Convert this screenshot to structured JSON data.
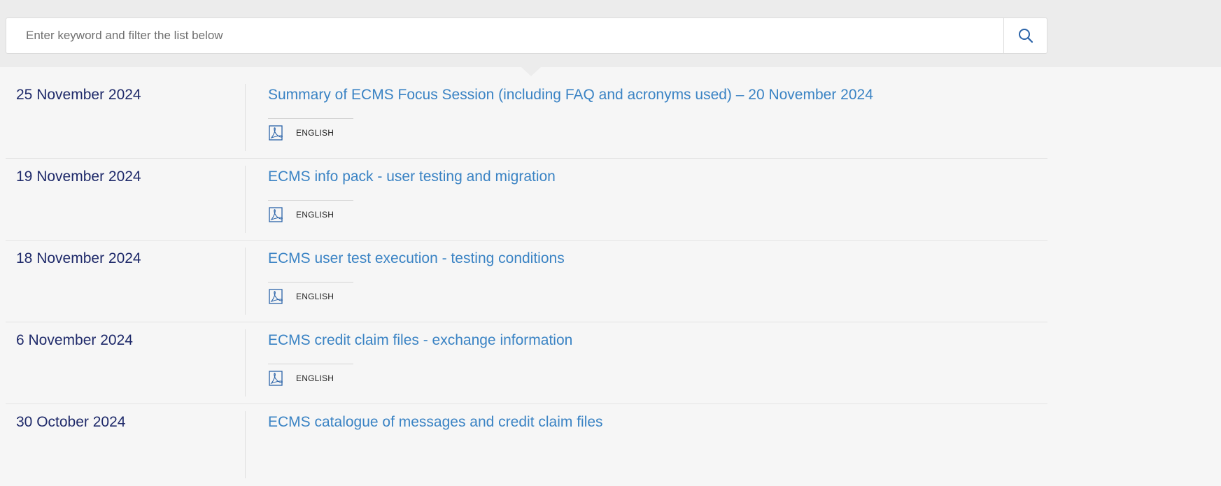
{
  "search": {
    "placeholder": "Enter keyword and filter the list below",
    "button_icon": "search-icon"
  },
  "colors": {
    "date": "#1f2a6a",
    "title_link": "#3a83c4",
    "band": "#ececec",
    "background": "#f6f6f6"
  },
  "items": [
    {
      "date": "25 November 2024",
      "title": "Summary of ECMS Focus Session (including FAQ and acronyms used) – 20 November 2024",
      "file_icon": "pdf-icon",
      "language": "ENGLISH"
    },
    {
      "date": "19 November 2024",
      "title": "ECMS info pack - user testing and migration",
      "file_icon": "pdf-icon",
      "language": "ENGLISH"
    },
    {
      "date": "18 November 2024",
      "title": "ECMS user test execution - testing conditions",
      "file_icon": "pdf-icon",
      "language": "ENGLISH"
    },
    {
      "date": "6 November 2024",
      "title": "ECMS credit claim files - exchange information",
      "file_icon": "pdf-icon",
      "language": "ENGLISH"
    },
    {
      "date": "30 October 2024",
      "title": "ECMS catalogue of messages and credit claim files"
    }
  ]
}
